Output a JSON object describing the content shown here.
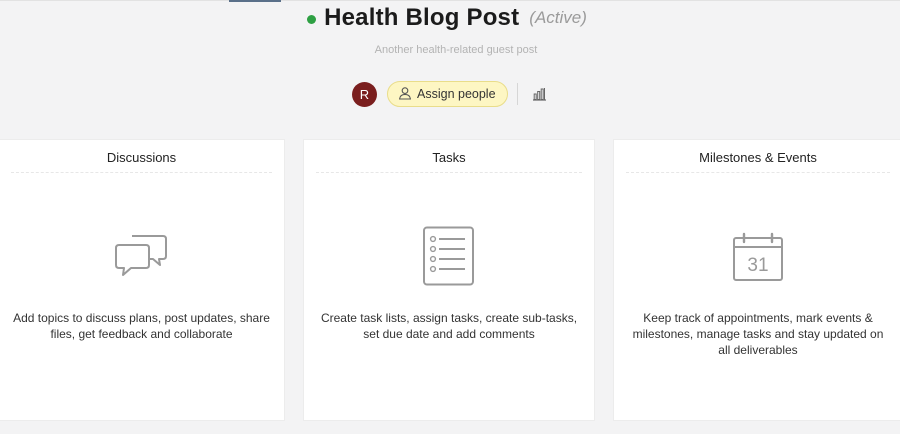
{
  "header": {
    "title": "Health Blog Post",
    "status": "(Active)",
    "status_color": "#2ea043",
    "subtitle": "Another health-related guest post"
  },
  "people": {
    "avatar_initial": "R",
    "avatar_color": "#7a1e1e",
    "assign_label": "Assign people",
    "stats_icon": "bar-chart-icon"
  },
  "cards": [
    {
      "title": "Discussions",
      "icon": "chat-bubbles-icon",
      "description": "Add topics to discuss plans, post updates, share files, get feedback and collaborate"
    },
    {
      "title": "Tasks",
      "icon": "task-list-icon",
      "description": "Create task lists, assign tasks, create sub-tasks, set due date and add comments"
    },
    {
      "title": "Milestones & Events",
      "icon": "calendar-icon",
      "calendar_day": "31",
      "description": "Keep track of appointments, mark events & milestones, manage tasks and stay updated on all deliverables"
    }
  ]
}
